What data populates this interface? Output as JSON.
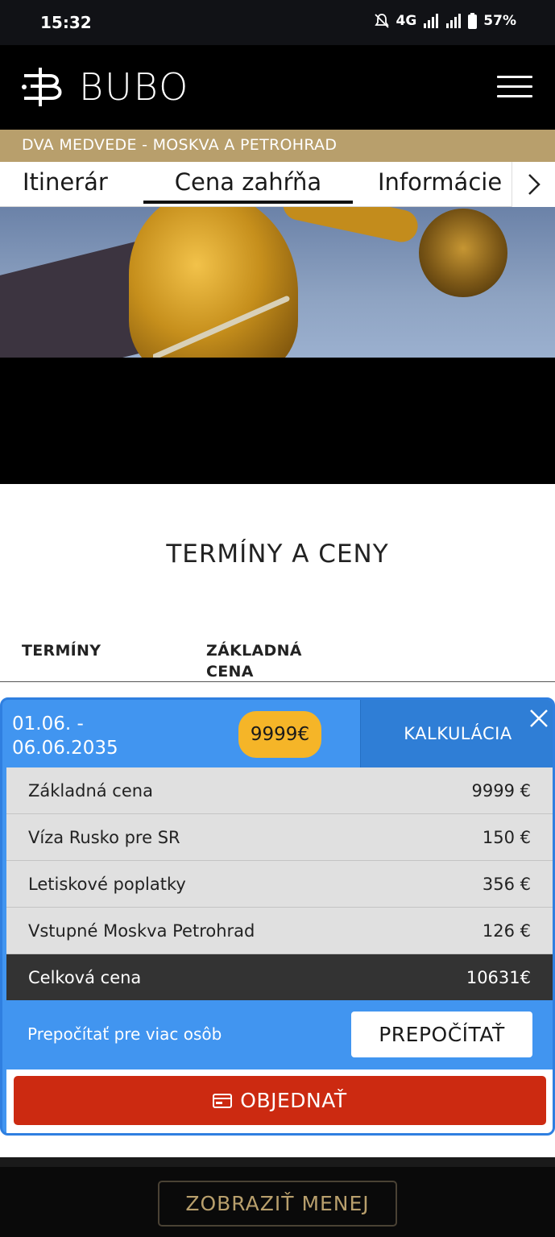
{
  "status_bar": {
    "time": "15:32",
    "network": "4G",
    "battery": "57%"
  },
  "header": {
    "brand": "BUBO",
    "menu_icon": "hamburger-icon"
  },
  "tour": {
    "title": "DVA MEDVEDE - MOSKVA A PETROHRAD"
  },
  "tabs": [
    {
      "label": "Itinerár",
      "active": false
    },
    {
      "label": "Cena zahŕňa",
      "active": true
    },
    {
      "label": "Informácie",
      "active": false
    }
  ],
  "section": {
    "title": "TERMÍNY A CENY",
    "col_terms": "TERMÍNY",
    "col_price_1": "ZÁKLADNÁ",
    "col_price_2": "CENA"
  },
  "calc": {
    "date_1": "01.06. -",
    "date_2": "06.06.2035",
    "price": "9999€",
    "calc_label": "KALKULÁCIA",
    "rows": [
      {
        "label": "Základná cena",
        "value": "9999 €"
      },
      {
        "label": "Víza Rusko pre SR",
        "value": "150 €"
      },
      {
        "label": "Letiskové poplatky",
        "value": "356 €"
      },
      {
        "label": "Vstupné Moskva Petrohrad",
        "value": "126 €"
      }
    ],
    "total": {
      "label": "Celková cena",
      "value": "10631€"
    },
    "recalc_label": "Prepočítať pre viac osôb",
    "recalc_button": "PREPOČÍTAŤ",
    "order_button": "OBJEDNAŤ"
  },
  "footer": {
    "currency_button": "ZOBRAZIŤ MENEJ"
  },
  "colors": {
    "accent_gold": "#b89f6c",
    "card_blue": "#4195f0",
    "order_red": "#cc2a11",
    "pill_yellow": "#f5b528"
  }
}
